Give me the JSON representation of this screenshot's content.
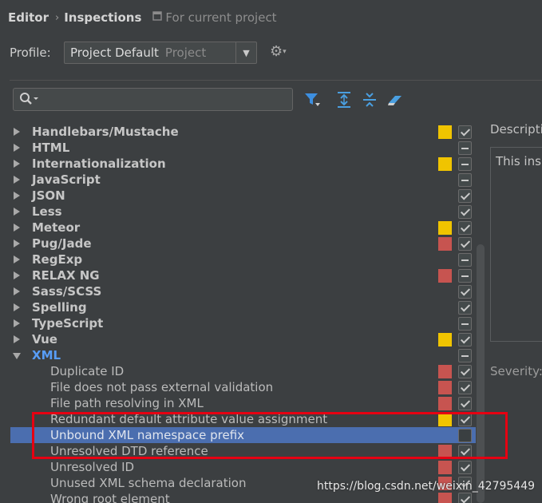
{
  "breadcrumb": {
    "part1": "Editor",
    "separator": "›",
    "part2": "Inspections",
    "scope": "For current project"
  },
  "profile": {
    "label": "Profile:",
    "value": "Project Default",
    "scope": "Project"
  },
  "toolbar": {
    "icons": [
      "search-icon",
      "filter-icon",
      "expand-all-icon",
      "collapse-all-icon",
      "reset-icon"
    ]
  },
  "colors": {
    "warning": "#f0c400",
    "error": "#c75450",
    "selection": "#4b6eaf",
    "link": "#589df6",
    "highlight_border": "#e60012"
  },
  "tree": [
    {
      "label": "Handlebars/Mustache",
      "type": "group",
      "expanded": false,
      "severity": "warning",
      "check": "checked"
    },
    {
      "label": "HTML",
      "type": "group",
      "expanded": false,
      "severity": "none",
      "check": "partial"
    },
    {
      "label": "Internationalization",
      "type": "group",
      "expanded": false,
      "severity": "warning",
      "check": "partial"
    },
    {
      "label": "JavaScript",
      "type": "group",
      "expanded": false,
      "severity": "none",
      "check": "partial"
    },
    {
      "label": "JSON",
      "type": "group",
      "expanded": false,
      "severity": "none",
      "check": "checked"
    },
    {
      "label": "Less",
      "type": "group",
      "expanded": false,
      "severity": "none",
      "check": "checked"
    },
    {
      "label": "Meteor",
      "type": "group",
      "expanded": false,
      "severity": "warning",
      "check": "checked"
    },
    {
      "label": "Pug/Jade",
      "type": "group",
      "expanded": false,
      "severity": "error",
      "check": "checked"
    },
    {
      "label": "RegExp",
      "type": "group",
      "expanded": false,
      "severity": "none",
      "check": "partial"
    },
    {
      "label": "RELAX NG",
      "type": "group",
      "expanded": false,
      "severity": "error",
      "check": "partial"
    },
    {
      "label": "Sass/SCSS",
      "type": "group",
      "expanded": false,
      "severity": "none",
      "check": "checked"
    },
    {
      "label": "Spelling",
      "type": "group",
      "expanded": false,
      "severity": "none",
      "check": "checked"
    },
    {
      "label": "TypeScript",
      "type": "group",
      "expanded": false,
      "severity": "none",
      "check": "partial"
    },
    {
      "label": "Vue",
      "type": "group",
      "expanded": false,
      "severity": "warning",
      "check": "checked"
    },
    {
      "label": "XML",
      "type": "group",
      "expanded": true,
      "severity": "none",
      "check": "partial"
    },
    {
      "label": "Duplicate ID",
      "type": "child",
      "severity": "error",
      "check": "checked"
    },
    {
      "label": "File does not pass external validation",
      "type": "child",
      "severity": "error",
      "check": "checked"
    },
    {
      "label": "File path resolving in XML",
      "type": "child",
      "severity": "error",
      "check": "checked"
    },
    {
      "label": "Redundant default attribute value assignment",
      "type": "child",
      "severity": "warning",
      "check": "checked"
    },
    {
      "label": "Unbound XML namespace prefix",
      "type": "child",
      "severity": "none",
      "check": "unchecked",
      "selected": true
    },
    {
      "label": "Unresolved DTD reference",
      "type": "child",
      "severity": "error",
      "check": "checked"
    },
    {
      "label": "Unresolved ID",
      "type": "child",
      "severity": "error",
      "check": "checked"
    },
    {
      "label": "Unused XML schema declaration",
      "type": "child",
      "severity": "error",
      "check": "checked"
    },
    {
      "label": "Wrong root element",
      "type": "child",
      "severity": "error",
      "check": "checked"
    }
  ],
  "description": {
    "label": "Descriptio",
    "text": "This insp"
  },
  "severity_label": "Severity:",
  "watermark": "https://blog.csdn.net/weixin_42795449"
}
